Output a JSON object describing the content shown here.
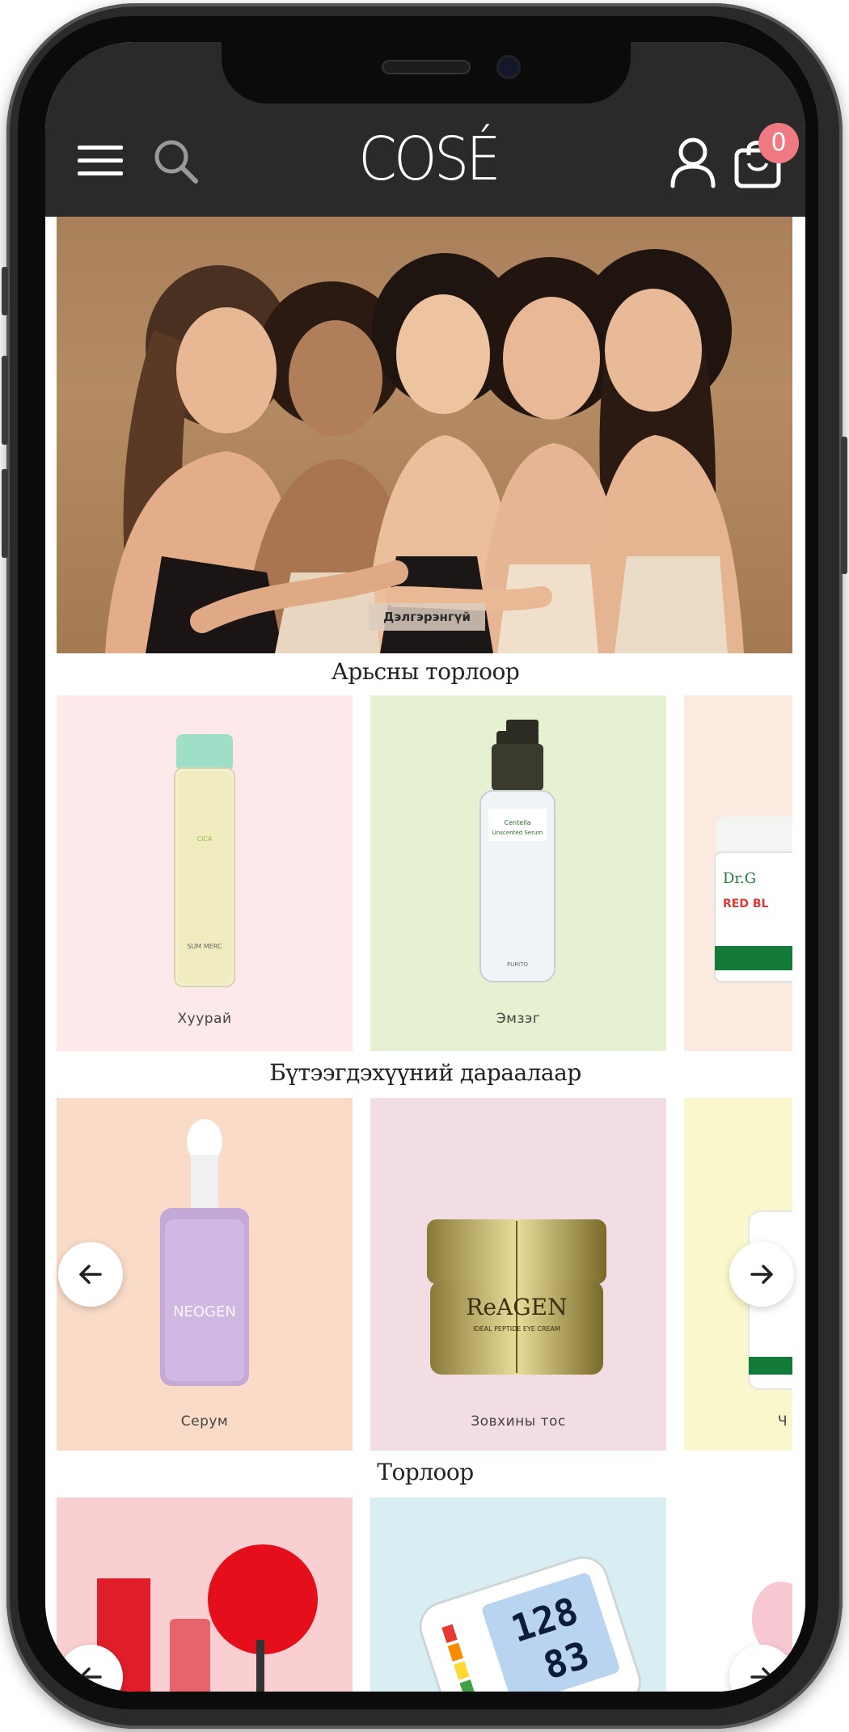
{
  "header": {
    "logo": "COSÉ",
    "cart_count": "0"
  },
  "hero": {
    "button_label": "Дэлгэрэнгүй"
  },
  "sections": [
    {
      "title": "Арьсны торлоор",
      "items": [
        {
          "label": "Хуурай",
          "bg": "#fde9ea"
        },
        {
          "label": "Эмзэг",
          "bg": "#e5f1d0"
        },
        {
          "label": "",
          "bg": "#fbeae0"
        }
      ]
    },
    {
      "title": "Бүтээгдэхүүний дараалаар",
      "items": [
        {
          "label": "Серум",
          "bg": "#f9dbc8"
        },
        {
          "label": "Зовхины тос",
          "bg": "#f2dde4"
        },
        {
          "label": "Ч",
          "bg": "#fbf7cc"
        }
      ]
    },
    {
      "title": "Торлоор",
      "items": [
        {
          "label": "",
          "bg": "#f9cfd2"
        },
        {
          "label": "",
          "bg": "#d9eef2"
        },
        {
          "label": "",
          "bg": "#ffffff"
        }
      ]
    }
  ],
  "products": {
    "serum_brand": "SUM MERC",
    "serum_name": "Centella Unscented Serum",
    "serum_footer": "PURITO",
    "cream_brand": "Dr.G",
    "cream_name": "RED BL",
    "neogen_name": "NEOGEN",
    "reagen_name": "ReAGEN",
    "reagen_sub": "IDEAL PEPTIDE EYE CREAM",
    "bp_reading_1": "128",
    "bp_reading_2": "83"
  },
  "colors": {
    "header_bg": "#2a2a2a",
    "badge": "#f07a83"
  }
}
